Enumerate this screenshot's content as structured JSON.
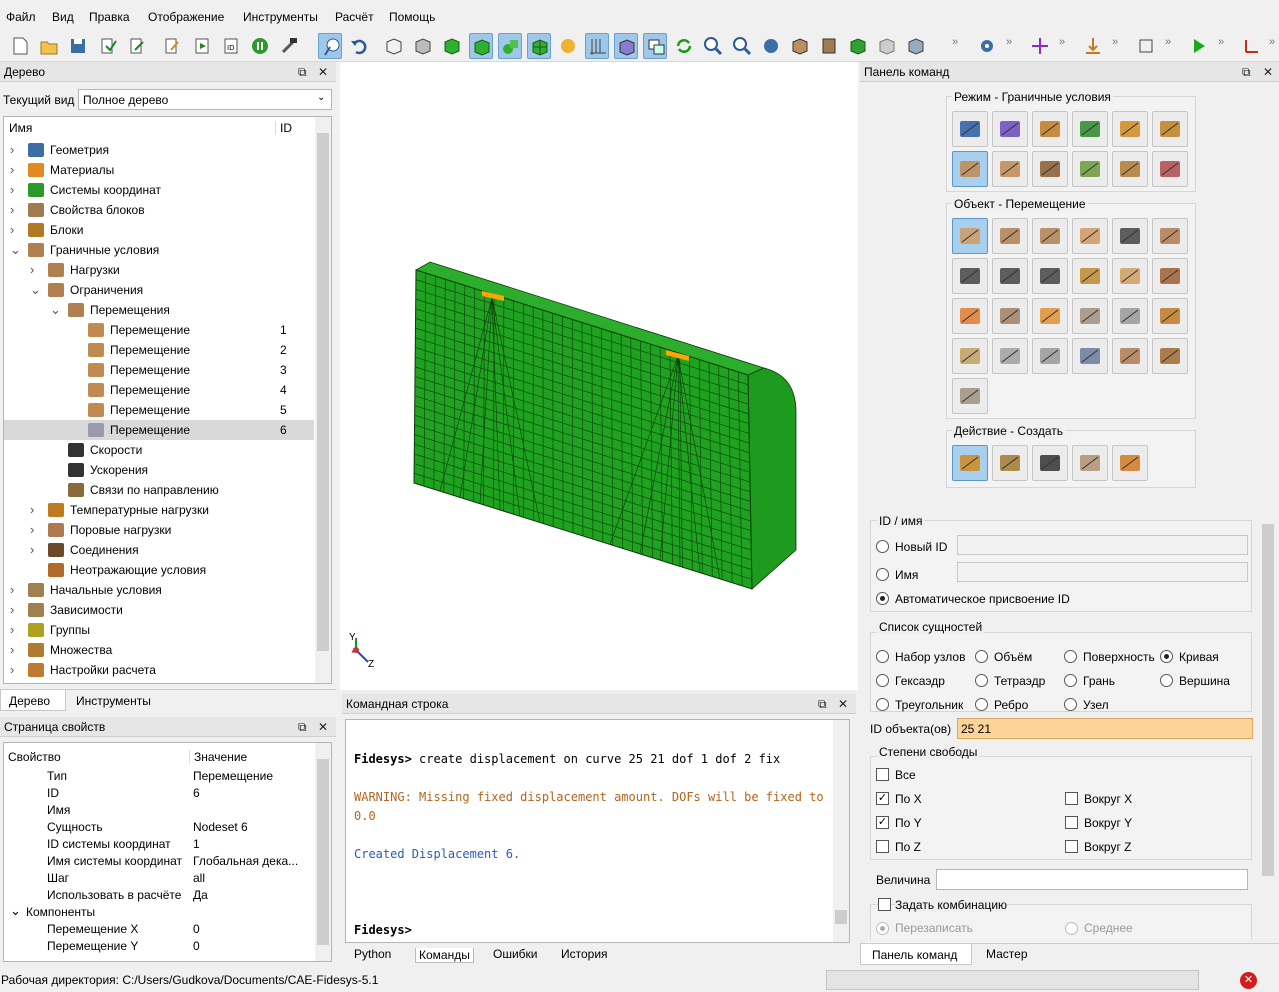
{
  "menu": [
    "Файл",
    "Вид",
    "Правка",
    "Отображение",
    "Инструменты",
    "Расчёт",
    "Помощь"
  ],
  "tree_panel": {
    "title": "Дерево",
    "current_view_label": "Текущий вид",
    "current_view_value": "Полное дерево",
    "col_name": "Имя",
    "col_id": "ID"
  },
  "tree": [
    {
      "label": "Геометрия",
      "id": ""
    },
    {
      "label": "Материалы",
      "id": ""
    },
    {
      "label": "Системы координат",
      "id": ""
    },
    {
      "label": "Свойства блоков",
      "id": ""
    },
    {
      "label": "Блоки",
      "id": ""
    },
    {
      "label": "Граничные условия",
      "id": ""
    },
    {
      "label": "Нагрузки",
      "id": ""
    },
    {
      "label": "Ограничения",
      "id": ""
    },
    {
      "label": "Перемещения",
      "id": ""
    },
    {
      "label": "Перемещение",
      "id": "1"
    },
    {
      "label": "Перемещение",
      "id": "2"
    },
    {
      "label": "Перемещение",
      "id": "3"
    },
    {
      "label": "Перемещение",
      "id": "4"
    },
    {
      "label": "Перемещение",
      "id": "5"
    },
    {
      "label": "Перемещение",
      "id": "6"
    },
    {
      "label": "Скорости",
      "id": ""
    },
    {
      "label": "Ускорения",
      "id": ""
    },
    {
      "label": "Связи по направлению",
      "id": ""
    },
    {
      "label": "Температурные нагрузки",
      "id": ""
    },
    {
      "label": "Поровые нагрузки",
      "id": ""
    },
    {
      "label": "Соединения",
      "id": ""
    },
    {
      "label": "Неотражающие условия",
      "id": ""
    },
    {
      "label": "Начальные условия",
      "id": ""
    },
    {
      "label": "Зависимости",
      "id": ""
    },
    {
      "label": "Группы",
      "id": ""
    },
    {
      "label": "Множества",
      "id": ""
    },
    {
      "label": "Настройки расчета",
      "id": ""
    }
  ],
  "left_tabs": [
    "Дерево",
    "Инструменты"
  ],
  "props": {
    "title": "Страница свойств",
    "col_prop": "Свойство",
    "col_val": "Значение",
    "rows": [
      [
        "Тип",
        "Перемещение"
      ],
      [
        "ID",
        "6"
      ],
      [
        "Имя",
        ""
      ],
      [
        "Сущность",
        "Nodeset 6"
      ],
      [
        "ID системы координат",
        "1"
      ],
      [
        "Имя системы координат",
        "Глобальная дека..."
      ],
      [
        "Шаг",
        "all"
      ],
      [
        "Использовать в расчёте",
        "Да"
      ],
      [
        "Компоненты",
        ""
      ],
      [
        "Перемещение X",
        "0"
      ],
      [
        "Перемещение Y",
        "0"
      ]
    ]
  },
  "viewport": {
    "axis_y": "Y",
    "axis_z": "Z"
  },
  "cmd": {
    "title": "Командная строка",
    "line1_prompt": "Fidesys>",
    "line1_cmd": " create displacement  on curve 25 21 dof 1 dof 2 fix",
    "warn1": "WARNING: Missing fixed displacement amount. DOFs will be fixed to",
    "warn2": "0.0",
    "created": "Created Displacement 6.",
    "prompt": "Fidesys>",
    "tabs": [
      "Python",
      "Команды",
      "Ошибки",
      "История"
    ]
  },
  "cmd_panel": {
    "title": "Панель команд",
    "mode_title": "Режим - Граничные условия",
    "object_title": "Объект - Перемещение",
    "action_title": "Действие - Создать",
    "id_group": "ID / имя",
    "new_id": "Новый ID",
    "name": "Имя",
    "auto_id": "Автоматическое присвоение ID",
    "entity_group": "Список сущностей",
    "entities": [
      "Набор узлов",
      "Объём",
      "Поверхность",
      "Кривая",
      "Гексаэдр",
      "Тетраэдр",
      "Грань",
      "Вершина",
      "Треугольник",
      "Ребро",
      "Узел"
    ],
    "obj_id_label": "ID объекта(ов)",
    "obj_id_value": "25 21",
    "dof_group": "Степени свободы",
    "dof_all": "Все",
    "dof_x": "По X",
    "dof_y": "По Y",
    "dof_z": "По Z",
    "rot_x": "Вокруг X",
    "rot_y": "Вокруг Y",
    "rot_z": "Вокруг Z",
    "value_label": "Величина",
    "combo": "Задать комбинацию",
    "overwrite": "Перезаписать",
    "average": "Среднее",
    "tabs": [
      "Панель команд",
      "Мастер"
    ]
  },
  "status": {
    "workdir": "Рабочая директория: C:/Users/Gudkova/Documents/CAE-Fidesys-5.1"
  },
  "colors": {
    "mesh": "#1fa21f",
    "highlight": "#ffa500",
    "selected_field": "#fcd49a",
    "active_button": "#a9cfef"
  }
}
